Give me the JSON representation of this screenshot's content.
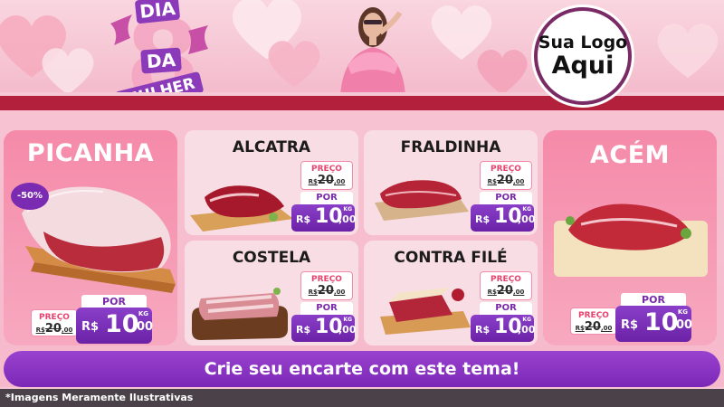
{
  "header": {
    "logo_line1": "DIA",
    "logo_line2": "DA",
    "logo_line3": "MULHER",
    "brand_line1": "Sua Logo",
    "brand_line2": "Aqui"
  },
  "featured_left": {
    "title": "PICANHA",
    "discount": "-50%",
    "preco_label": "PREÇO",
    "old_currency": "R$",
    "old_price": "20",
    "old_cents": ",00",
    "por_label": "POR",
    "currency": "R$",
    "price": "10",
    "cents": ",00",
    "unit": "KG"
  },
  "featured_right": {
    "title": "ACÉM",
    "preco_label": "PREÇO",
    "old_currency": "R$",
    "old_price": "20",
    "old_cents": ",00",
    "por_label": "POR",
    "currency": "R$",
    "price": "10",
    "cents": ",00",
    "unit": "KG"
  },
  "products": [
    {
      "title": "ALCATRA",
      "preco_label": "PREÇO",
      "old_currency": "R$",
      "old_price": "20",
      "old_cents": ",00",
      "por_label": "POR",
      "currency": "R$",
      "price": "10",
      "cents": ",00",
      "unit": "KG"
    },
    {
      "title": "FRALDINHA",
      "preco_label": "PREÇO",
      "old_currency": "R$",
      "old_price": "20",
      "old_cents": ",00",
      "por_label": "POR",
      "currency": "R$",
      "price": "10",
      "cents": ",00",
      "unit": "KG"
    },
    {
      "title": "COSTELA",
      "preco_label": "PREÇO",
      "old_currency": "R$",
      "old_price": "20",
      "old_cents": ",00",
      "por_label": "POR",
      "currency": "R$",
      "price": "10",
      "cents": ",00",
      "unit": "KG"
    },
    {
      "title": "CONTRA FILÉ",
      "preco_label": "PREÇO",
      "old_currency": "R$",
      "old_price": "20",
      "old_cents": ",00",
      "por_label": "POR",
      "currency": "R$",
      "price": "10",
      "cents": ",00",
      "unit": "KG"
    }
  ],
  "cta": "Crie seu encarte com este tema!",
  "footer": "*Imagens Meramente Ilustrativas",
  "colors": {
    "accent_purple": "#7b27b6",
    "featured_pink": "#f58aa9",
    "header_red": "#b3203c",
    "card_bg": "#f9dde5"
  }
}
